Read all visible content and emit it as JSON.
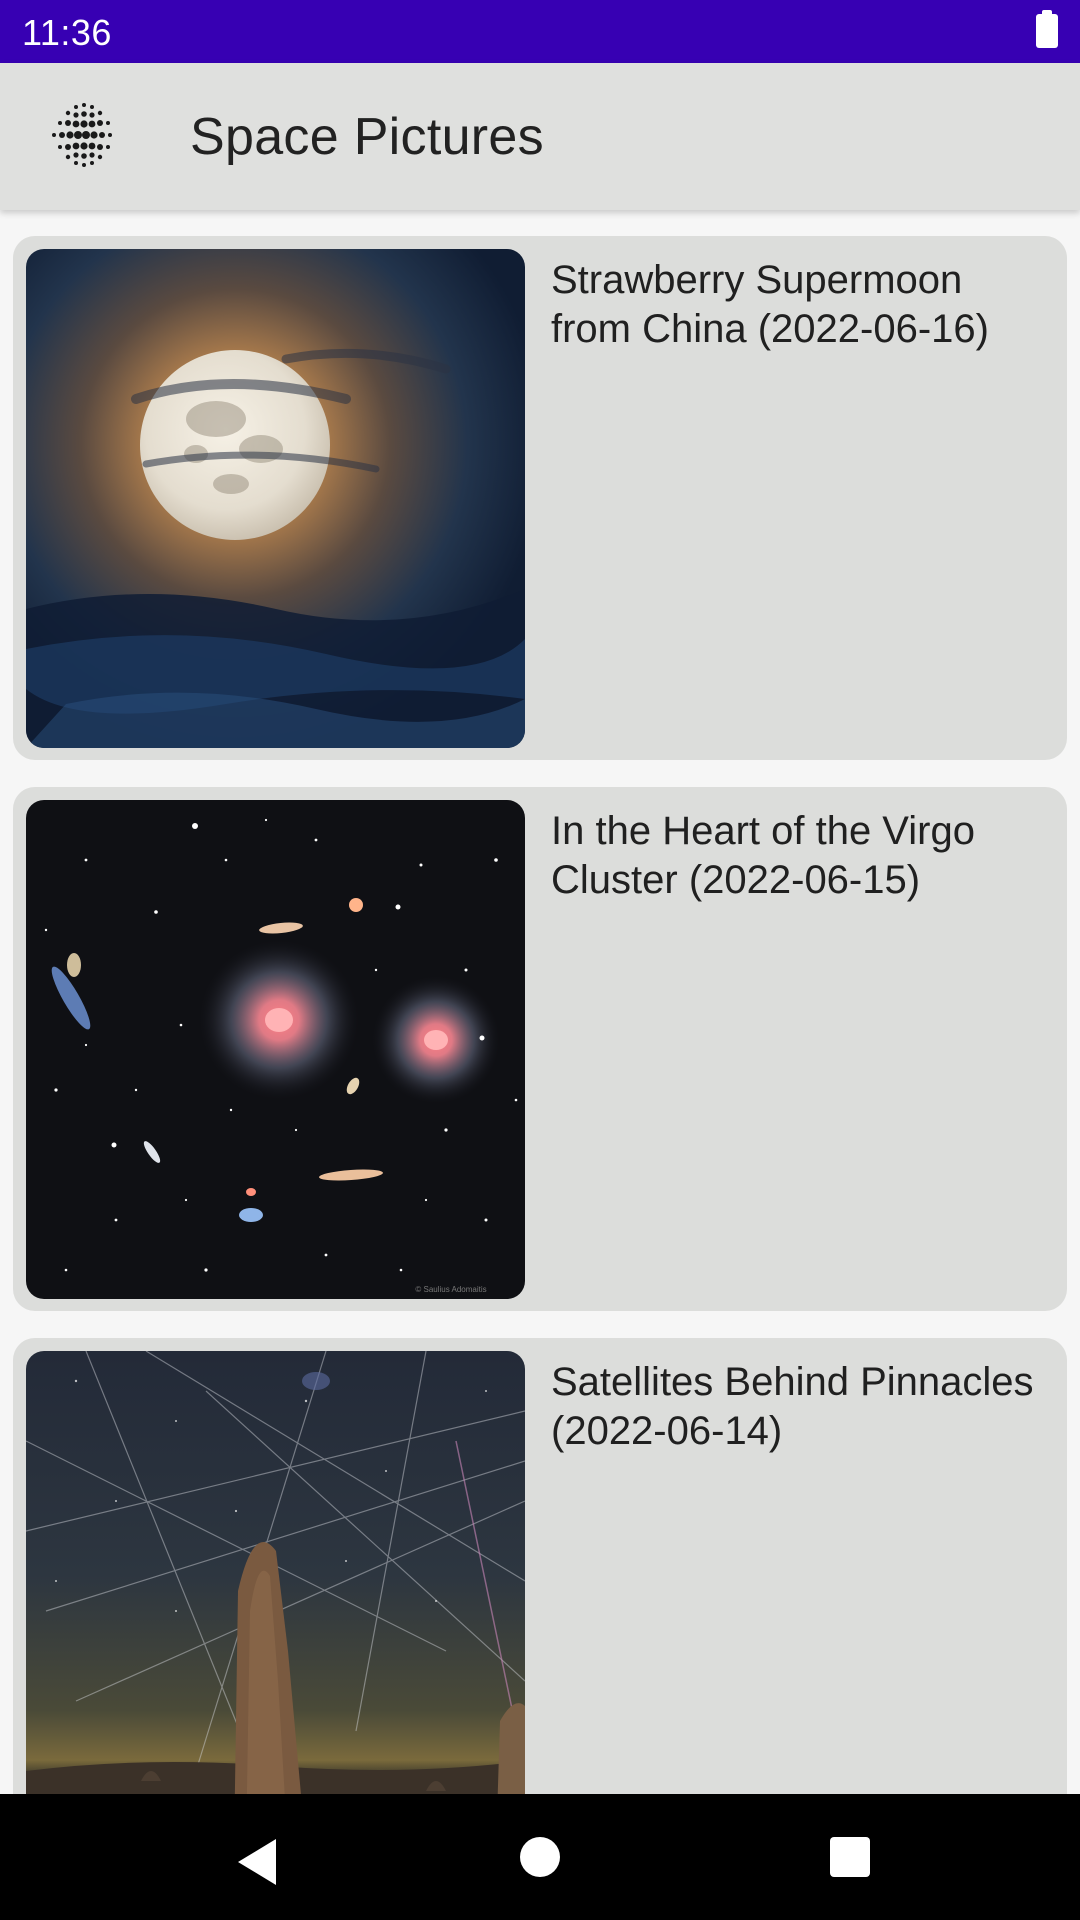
{
  "status_bar": {
    "time": "11:36",
    "battery_icon": "battery-full-icon"
  },
  "app_bar": {
    "title": "Space Pictures",
    "logo_icon": "dotted-sphere-logo-icon"
  },
  "pictures": [
    {
      "title": "Strawberry Supermoon from China (2022-06-16)",
      "image": "full-moon-behind-clouds"
    },
    {
      "title": "In the Heart of the Virgo Cluster (2022-06-15)",
      "image": "galaxy-cluster-starfield",
      "credit": "© Saulius Adomaitis"
    },
    {
      "title": "Satellites Behind Pinnacles (2022-06-14)",
      "image": "rock-pinnacle-with-satellite-trails"
    }
  ],
  "nav_bar": {
    "back_icon": "back-triangle-icon",
    "home_icon": "home-circle-icon",
    "recents_icon": "recents-square-icon"
  }
}
